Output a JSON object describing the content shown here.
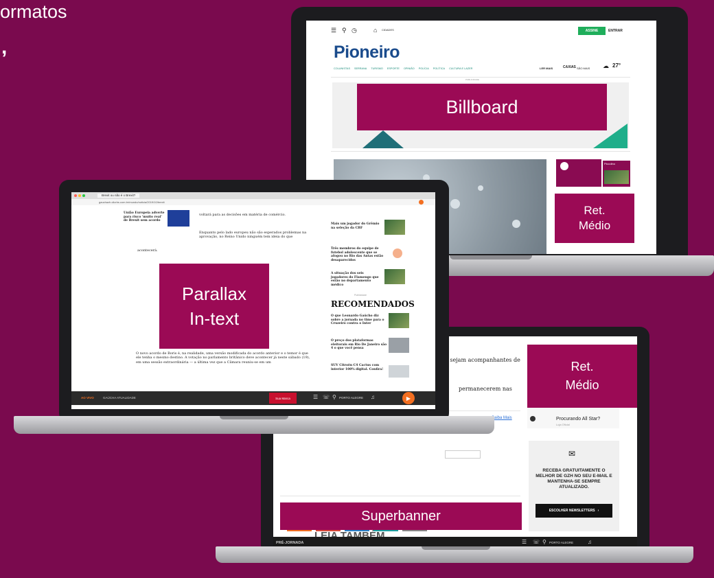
{
  "heading": {
    "line1": "ormatos",
    "line2": ","
  },
  "desktop": {
    "brand": "Pioneiro",
    "subscribe": "ASSINE",
    "login": "ENTRAR",
    "search_menu": "CIDADES",
    "nav": [
      "COLUNISTAS",
      "SERRANA",
      "TURISMO",
      "ESPORTE",
      "OPINIÃO",
      "POLÍCIA",
      "POLÍTICA",
      "CULTURA E LAZER"
    ],
    "util": [
      "LER MAIS",
      "CAXIAS",
      "SÃO MAIS"
    ],
    "weather": "27°",
    "ad_caption": "PUBLICIDADE",
    "promo_title": "Piccolino",
    "billboard_label": "Billboard",
    "ret_label_1": "Ret.",
    "ret_label_2": "Médio"
  },
  "left": {
    "tab_title": "Brexit ou não é o Brexit?",
    "url": "gauchazh.clicrbs.com.br/mundo/noticia/2019/10/brexit",
    "article_caption": "União Europeia adverte para risco 'muito real' de Brexit sem acordo",
    "p1": "voltará para as decisões em matéria de comércio.",
    "p2": "Enquanto pelo lado europeu não são esperados problemas na aprovação, no Reino Unido ninguém tem ideia do que",
    "p3": "acontecerá.",
    "p4": "O novo acordo de Boris é, na realidade, uma versão modificada do acordo anterior e o temor é que ele tenha o mesmo destino. A votação no parlamento britânico deve acontecer já neste sábado (19), em uma sessão extraordinária — a última vez que a Câmara reuniu-se em um",
    "parallax_line1": "Parallax",
    "parallax_line2": "In-text",
    "sidebar_items": [
      "Mais um jogador do Grêmio na seleção da CBF",
      "Três membros do equipe de futebol adolescente que se afogou no Rio das Antas estão desaparecidos",
      "A situação dos seis jogadores do Flamengo que estão no departamento médico"
    ],
    "recommended_small": "Publicidade",
    "recommended_title": "RECOMENDADOS",
    "rec_items": [
      "O que Leonardo Gaúcho diz sobre a jornada no time para o Cruzeiro contra o Inter",
      "O preço dos plataformas eleitorais em Rio De Janeiro são 4 o que você pensa",
      "SUV Citroën C4 Cactus com interior 100% digital. Confira!"
    ],
    "player_station": "GAÚCHA ATUALIDADE",
    "player_time": "AO VIVO",
    "player_city": "PORTO ALEGRE",
    "ad_badge": "Sua Marca"
  },
  "right": {
    "text1": "o sejam acompanhantes de",
    "text2": "permanecerem nas",
    "link": "Saiba Mais",
    "ret_label_1": "Ret.",
    "ret_label_2": "Médio",
    "ad_question": "Procurando All Star?",
    "ad_sub": "Loja Oficial",
    "newsletter": "RECEBA GRATUITAMENTE O MELHOR DE GZH NO SEU E-MAIL E MANTENHA-SE SEMPRE ATUALIZADO.",
    "newsletter_btn": "ESCOLHER NEWSLETTERS",
    "also_read": "LEIA TAMBÉM",
    "superbanner_label": "Superbanner",
    "player_title": "PRÉ-JORNADA",
    "player_city": "PORTO ALEGRE"
  },
  "colors": {
    "background": "#7a0a4e",
    "label_box": "#9b0a55",
    "green": "#1fae5b",
    "orange": "#f36f21"
  }
}
